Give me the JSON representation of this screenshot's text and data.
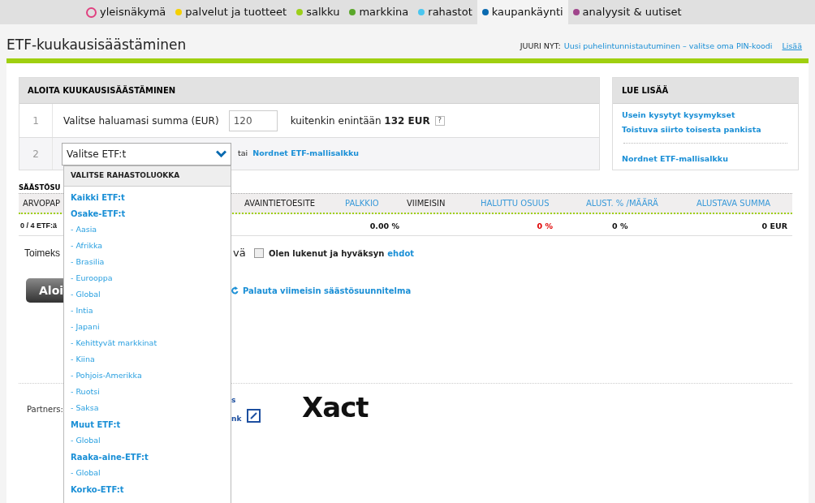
{
  "nav": {
    "items": [
      {
        "label": "yleisnäkymä",
        "kind": "ring",
        "color": "#e0407f",
        "selected": false
      },
      {
        "label": "palvelut ja tuotteet",
        "kind": "dot",
        "color": "#f5d000",
        "selected": false
      },
      {
        "label": "salkku",
        "kind": "dot",
        "color": "#9ccf1a",
        "selected": false
      },
      {
        "label": "markkina",
        "kind": "dot",
        "color": "#5aa72a",
        "selected": false
      },
      {
        "label": "rahastot",
        "kind": "dot",
        "color": "#4ac6ef",
        "selected": false
      },
      {
        "label": "kaupankäynti",
        "kind": "dot",
        "color": "#0a6ab0",
        "selected": true
      },
      {
        "label": "analyysit & uutiset",
        "kind": "dot",
        "color": "#a0458c",
        "selected": false
      }
    ]
  },
  "page_title": "ETF-kuukausisäästäminen",
  "notice": {
    "label": "JUURI NYT:",
    "message": "Uusi puhelintunnistautuminen – valitse oma PIN-koodi",
    "more": "Lisää"
  },
  "start_panel": {
    "title": "ALOITA KUUKAUSISÄÄSTÄMINEN",
    "step_1": {
      "number": "1",
      "label": "Valitse haluamasi summa (EUR)",
      "amount": "120",
      "limit": "kuitenkin enintään **132 EUR**",
      "help": "?"
    },
    "step_2": {
      "number": "2",
      "select": {
        "value": "Valitse ETF:t",
        "expanded": true
      },
      "or": "tai",
      "link": "Nordnet ETF-mallisalkku"
    }
  },
  "read_more": {
    "title": "LUE LISÄÄ",
    "links": [
      "Usein kysytyt kysymykset",
      "Toistuva siirto toisesta pankista"
    ],
    "extra_link": "Nordnet ETF-mallisalkku"
  },
  "plan": {
    "title": "SÄÄSTÖSU",
    "columns": [
      {
        "label": "ARVOPAP",
        "sortable": false
      },
      {
        "label": "AVAINTIETOESITE",
        "sortable": false
      },
      {
        "label": "PALKKIO",
        "sortable": true
      },
      {
        "label": "VIIMEISIN",
        "sortable": false
      },
      {
        "label": "HALUTTU OSUUS",
        "sortable": true
      },
      {
        "label": "ALUST. % /MÄÄRÄ",
        "sortable": true
      },
      {
        "label": "ALUSTAVA SUMMA",
        "sortable": true
      }
    ],
    "row": {
      "count": "0 / 4 ETF:ä",
      "fee": "0.00 %",
      "wanted_share": "0 %",
      "preliminary_share": "0 %",
      "preliminary_sum": "0 EUR"
    }
  },
  "order_text": "Toimeks",
  "order_text_end": "vä",
  "terms": {
    "checked": false,
    "label": "Olen lukenut ja hyväksyn",
    "link": "ehdot"
  },
  "start_button": "Aloi",
  "restore_link": "Palauta viimeisin säästösuunnitelma",
  "partners": {
    "label": "Partners:",
    "fragment_1": "s",
    "fragment_2": "nk",
    "logo": "Xact"
  },
  "dropdown": {
    "title": "VALITSE RAHASTOLUOKKA",
    "items": [
      {
        "label": "Kaikki ETF:t",
        "kind": "category"
      },
      {
        "label": "Osake-ETF:t",
        "kind": "category"
      },
      {
        "label": "- Aasia",
        "kind": "sub"
      },
      {
        "label": "- Afrikka",
        "kind": "sub"
      },
      {
        "label": "- Brasilia",
        "kind": "sub"
      },
      {
        "label": "- Eurooppa",
        "kind": "sub"
      },
      {
        "label": "- Global",
        "kind": "sub"
      },
      {
        "label": "- Intia",
        "kind": "sub"
      },
      {
        "label": "- Japani",
        "kind": "sub"
      },
      {
        "label": "- Kehittyvät markkinat",
        "kind": "sub"
      },
      {
        "label": "- Kiina",
        "kind": "sub"
      },
      {
        "label": "- Pohjois-Amerikka",
        "kind": "sub"
      },
      {
        "label": "- Ruotsi",
        "kind": "sub"
      },
      {
        "label": "- Saksa",
        "kind": "sub"
      },
      {
        "label": "Muut ETF:t",
        "kind": "category"
      },
      {
        "label": "- Global",
        "kind": "sub"
      },
      {
        "label": "Raaka-aine-ETF:t",
        "kind": "category"
      },
      {
        "label": "- Global",
        "kind": "sub"
      },
      {
        "label": "Korko-ETF:t",
        "kind": "category"
      }
    ]
  }
}
